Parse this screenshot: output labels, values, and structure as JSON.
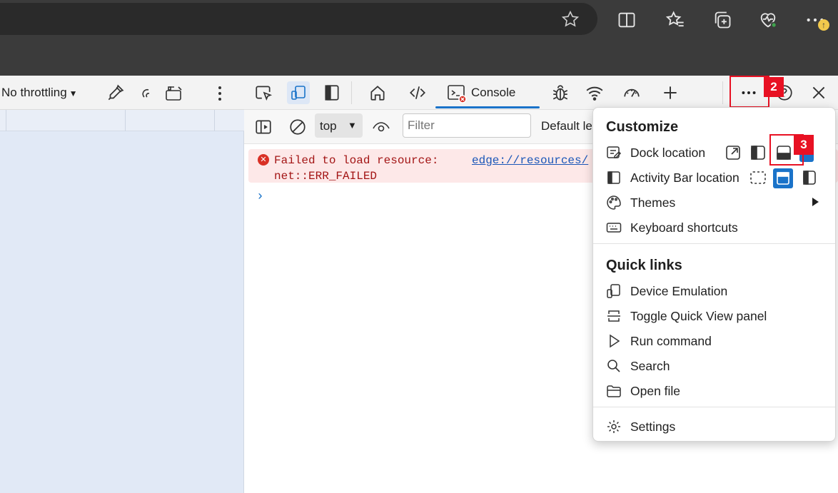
{
  "browser": {
    "icons": [
      "favorite-star-icon",
      "split-screen-icon",
      "favorites-icon",
      "collections-icon",
      "browser-essentials-icon",
      "more-icon"
    ],
    "update_badge": "↑"
  },
  "left_panel": {
    "throttling_label": "No throttling"
  },
  "devtools": {
    "tabs": {
      "console_label": "Console"
    },
    "console_toolbar": {
      "context_value": "top",
      "filter_placeholder": "Filter",
      "levels_label": "Default levels"
    },
    "messages": [
      {
        "type": "error",
        "text": "Failed to load resource:\nnet::ERR_FAILED",
        "source": "edge://resources/"
      }
    ],
    "prompt": "›"
  },
  "annotations": {
    "step2": "2",
    "step3": "3"
  },
  "menu": {
    "customize_heading": "Customize",
    "customize_items": [
      {
        "label": "Dock location",
        "icon": "dock-location-icon"
      },
      {
        "label": "Activity Bar location",
        "icon": "activity-bar-icon"
      },
      {
        "label": "Themes",
        "icon": "themes-palette-icon"
      },
      {
        "label": "Keyboard shortcuts",
        "icon": "keyboard-icon"
      }
    ],
    "quick_links_heading": "Quick links",
    "quick_links": [
      {
        "label": "Device Emulation",
        "icon": "device-emulation-icon"
      },
      {
        "label": "Toggle Quick View panel",
        "icon": "quick-view-icon"
      },
      {
        "label": "Run command",
        "icon": "run-command-icon"
      },
      {
        "label": "Search",
        "icon": "search-icon"
      },
      {
        "label": "Open file",
        "icon": "folder-icon"
      }
    ],
    "settings_label": "Settings",
    "accent_color": "#1a73c9",
    "highlight_color": "#e81123"
  }
}
